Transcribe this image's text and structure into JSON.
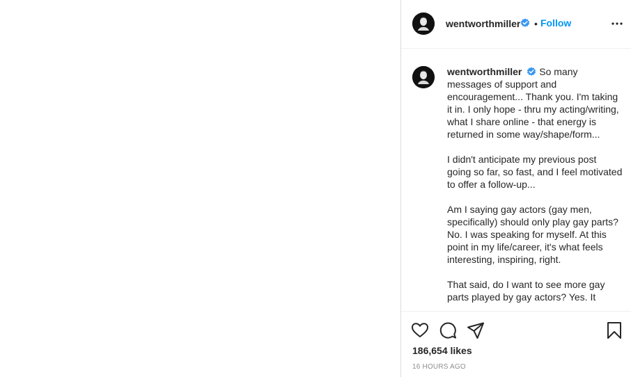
{
  "post": {
    "username": "wentworthmiller",
    "separator": "•",
    "follow_label": "Follow",
    "caption": "So many messages of support and encouragement... Thank you. I'm taking it in. I only hope - thru my acting/writing, what I share online - that energy is returned in some way/shape/form...\n\nI didn't anticipate my previous post going so far, so fast, and I feel motivated to offer a follow-up...\n\nAm I saying gay actors (gay men, specifically) should only play gay parts? No. I was speaking for myself. At this point in my life/career, it's what feels interesting, inspiring, right.\n\nThat said, do I want to see more gay parts played by gay actors? Yes. It",
    "likes": "186,654 likes",
    "timestamp": "16 HOURS AGO"
  },
  "icons": {
    "verified": "verified-badge-icon",
    "more": "more-options-icon",
    "like": "heart-icon",
    "comment": "comment-icon",
    "share": "share-icon",
    "save": "bookmark-icon"
  },
  "colors": {
    "accent": "#0095f6",
    "text": "#262626",
    "muted": "#8e8e8e",
    "border": "#dbdbdb"
  }
}
